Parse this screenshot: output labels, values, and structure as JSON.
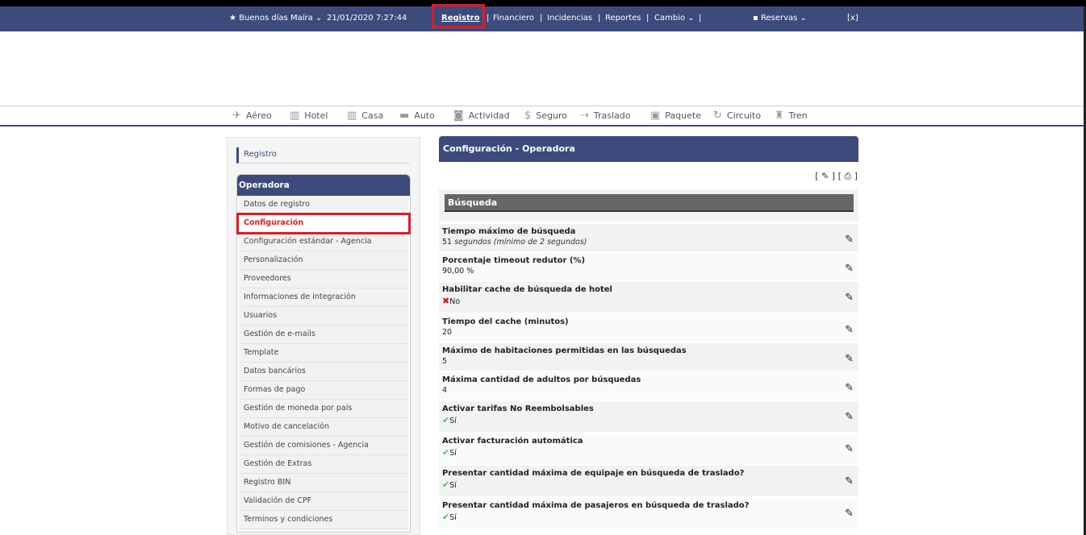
{
  "topbar": {
    "greeting": "Buenos días Maíra",
    "datetime": "21/01/2020 7:27:44",
    "nav": [
      "Registro",
      "Financiero",
      "Incidencias",
      "Reportes",
      "Cambio"
    ],
    "reservas": "Reservas",
    "close": "[x]"
  },
  "modes": [
    "Aéreo",
    "Hotel",
    "Casa",
    "Auto",
    "Actividad",
    "Seguro",
    "Traslado",
    "Paquete",
    "Circuito",
    "Tren"
  ],
  "sidebar": {
    "registro": "Registro",
    "header": "Operadora",
    "items": [
      "Datos de registro",
      "Configuración",
      "Configuración estándar - Agencia",
      "Personalización",
      "Proveedores",
      "Informaciones de integración",
      "Usuarios",
      "Gestión de e-mails",
      "Template",
      "Datos bancários",
      "Formas de pago",
      "Gestión de moneda por país",
      "Motivo de cancelación",
      "Gestión de comisiones - Agencia",
      "Gestión de Extras",
      "Registro BIN",
      "Validación de CPF",
      "Terminos y condiciones"
    ]
  },
  "main": {
    "title": "Configuración - Operadora",
    "section": "Búsqueda",
    "rows": [
      {
        "label": "Tiempo máximo de búsqueda",
        "value": "51",
        "note": "segundos (mínimo de 2 segundos)"
      },
      {
        "label": "Porcentaje timeout redutor (%)",
        "value": "90,00  %"
      },
      {
        "label": "Habilitar cache de búsqueda de hotel",
        "value": "No"
      },
      {
        "label": "Tiempo del cache (minutos)",
        "value": "20"
      },
      {
        "label": "Máximo de habitaciones permitidas en las búsquedas",
        "value": "5"
      },
      {
        "label": "Máxima cantidad de adultos por búsquedas",
        "value": "4"
      },
      {
        "label": "Activar tarifas No Reembolsables",
        "value": "Sí"
      },
      {
        "label": "Activar facturación automática",
        "value": "Sí"
      },
      {
        "label": "Presentar cantidad máxima de equipaje en búsqueda de traslado?",
        "value": "Sí"
      },
      {
        "label": "Presentar cantidad máxima de pasajeros en búsqueda de traslado?",
        "value": "Sí"
      }
    ]
  }
}
